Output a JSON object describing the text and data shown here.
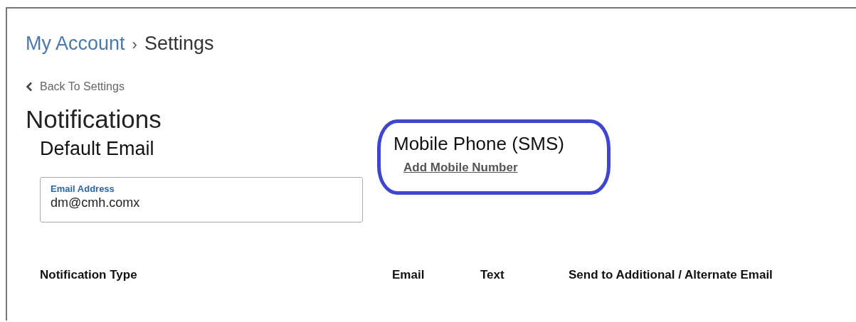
{
  "breadcrumb": {
    "parent": "My Account",
    "separator": "›",
    "current": "Settings"
  },
  "back_link": {
    "label": "Back To Settings"
  },
  "page_title": "Notifications",
  "default_email": {
    "heading": "Default Email",
    "field": {
      "label": "Email Address",
      "value": "dm@cmh.comx"
    }
  },
  "mobile_phone": {
    "heading": "Mobile Phone (SMS)",
    "link": "Add Mobile Number",
    "highlighted": true
  },
  "table": {
    "columns": [
      "Notification Type",
      "Email",
      "Text",
      "Send to Additional / Alternate Email"
    ]
  }
}
